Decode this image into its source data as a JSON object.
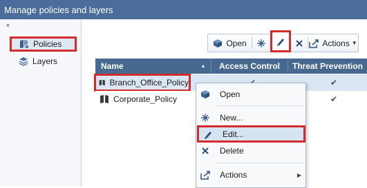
{
  "window": {
    "title": "Manage policies and layers"
  },
  "sidebar": {
    "collapse_glyph": "«",
    "items": [
      {
        "label": "Policies",
        "icon": "policies-icon",
        "selected": true
      },
      {
        "label": "Layers",
        "icon": "layers-icon",
        "selected": false
      }
    ]
  },
  "toolbar": {
    "open_label": "Open",
    "actions_label": "Actions"
  },
  "table": {
    "columns": [
      "Name",
      "Access Control",
      "Threat Prevention"
    ],
    "rows": [
      {
        "name": "Branch_Office_Policy",
        "access_control": true,
        "threat_prevention": true,
        "selected": true
      },
      {
        "name": "Corporate_Policy",
        "access_control": true,
        "threat_prevention": true,
        "selected": false
      }
    ]
  },
  "context_menu": {
    "items": [
      {
        "label": "Open",
        "icon": "open-icon"
      },
      {
        "label": "New...",
        "icon": "new-icon"
      },
      {
        "label": "Edit...",
        "icon": "edit-icon",
        "highlighted": true
      },
      {
        "label": "Delete",
        "icon": "delete-icon"
      },
      {
        "label": "Actions",
        "icon": "actions-icon",
        "submenu": true
      }
    ]
  },
  "colors": {
    "title_bar": "#4a6d9c",
    "table_header": "#47698f",
    "selection": "#dae6f3",
    "annotation_red": "#d42a2a"
  }
}
